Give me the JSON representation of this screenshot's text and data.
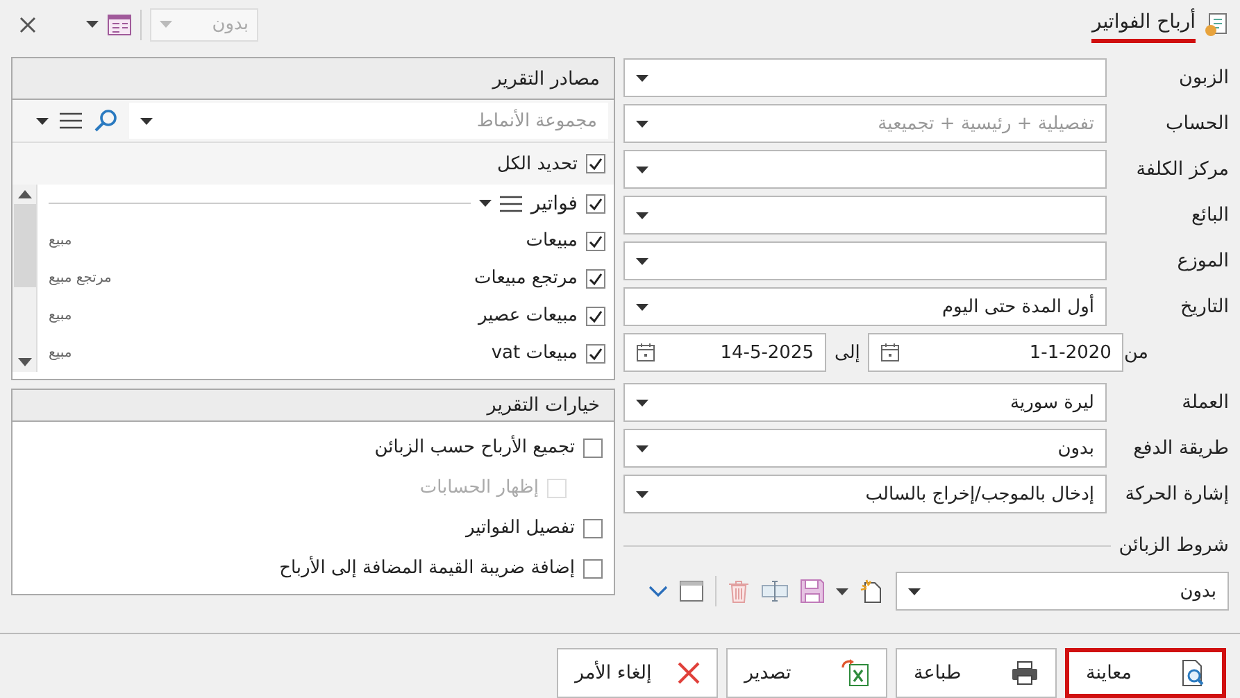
{
  "window": {
    "title": "أرباح الفواتير",
    "title_underlined": true,
    "layout_dropdown": {
      "value": "بدون",
      "disabled": true
    }
  },
  "filters": [
    {
      "label": "الزبون"
    },
    {
      "label": "الحساب",
      "placeholder": "تفصيلية + رئيسية + تجميعية"
    },
    {
      "label": "مركز الكلفة"
    },
    {
      "label": "البائع"
    },
    {
      "label": "الموزع"
    },
    {
      "label": "التاريخ",
      "value": "أول المدة حتى اليوم"
    }
  ],
  "date_range": {
    "from_label": "من",
    "from": "1-1-2020",
    "to_label": "إلى",
    "to": "14-5-2025"
  },
  "filters_2": [
    {
      "label": "العملة",
      "value": "ليرة سورية"
    },
    {
      "label": "طريقة الدفع",
      "value": "بدون"
    },
    {
      "label": "إشارة الحركة",
      "value": "إدخال بالموجب/إخراج بالسالب"
    }
  ],
  "customer_conditions": {
    "title": "شروط الزبائن",
    "value": "بدون"
  },
  "report_sources": {
    "title": "مصادر التقرير",
    "search_placeholder": "مجموعة الأنماط",
    "select_all": {
      "label": "تحديد الكل",
      "checked": true
    },
    "groups": [
      {
        "label": "فواتير",
        "checked": true,
        "children": [
          {
            "label": "مبيعات",
            "type": "مبيع",
            "checked": true
          },
          {
            "label": "مرتجع مبيعات",
            "type": "مرتجع مبيع",
            "checked": true
          },
          {
            "label": "مبيعات عصير",
            "type": "مبيع",
            "checked": true
          },
          {
            "label": "مبيعات vat",
            "type": "مبيع",
            "checked": true
          }
        ]
      }
    ]
  },
  "report_options": {
    "title": "خيارات التقرير",
    "options": [
      {
        "label": "تجميع الأرباح حسب الزبائن",
        "checked": false,
        "disabled": false,
        "indented": false
      },
      {
        "label": "إظهار الحسابات",
        "checked": false,
        "disabled": true,
        "indented": true
      },
      {
        "label": "تفصيل الفواتير",
        "checked": false,
        "disabled": false,
        "indented": false
      },
      {
        "label": "إضافة ضريبة القيمة المضافة إلى الأرباح",
        "checked": false,
        "disabled": false,
        "indented": false
      }
    ]
  },
  "buttons": [
    {
      "label": "معاينة",
      "kind": "preview",
      "highlighted": true
    },
    {
      "label": "طباعة",
      "kind": "print",
      "highlighted": false
    },
    {
      "label": "تصدير",
      "kind": "export",
      "highlighted": false
    },
    {
      "label": "إلغاء الأمر",
      "kind": "cancel",
      "highlighted": false
    }
  ]
}
